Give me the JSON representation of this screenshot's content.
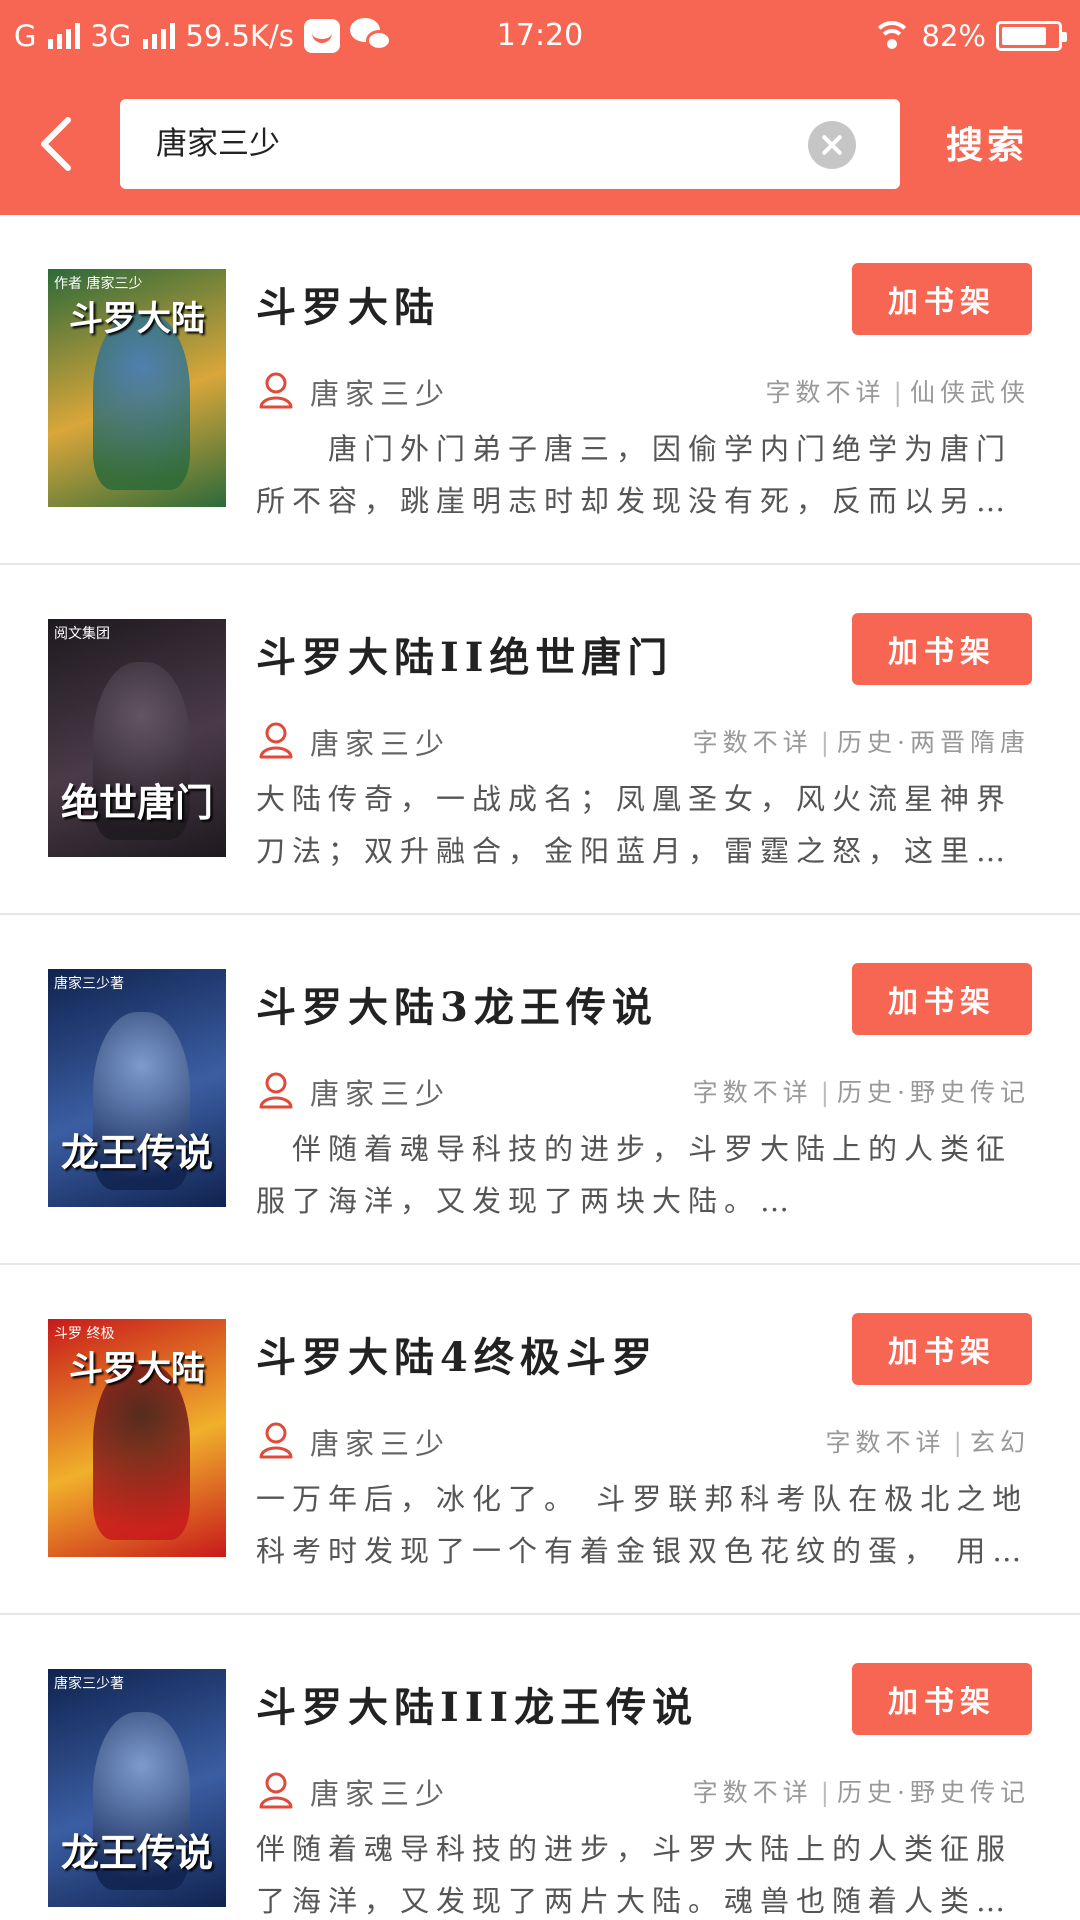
{
  "status_bar": {
    "carrier_1": "G",
    "carrier_2": "3G",
    "net_speed": "59.5K/s",
    "time": "17:20",
    "battery_text": "82%",
    "battery_level": 0.82
  },
  "header": {
    "back_icon": "chevron-left-icon",
    "search_value": "唐家三少",
    "search_button": "搜索",
    "accent_color": "#f66652"
  },
  "books": [
    {
      "title": "斗罗大陆",
      "author": "唐家三少",
      "word_count": "字数不详",
      "category": "仙侠武侠",
      "description": "　　唐门外门弟子唐三，因偷学内门绝学为唐门所不容，跳崖明志时却发现没有死，反而以另…",
      "add_label": "加书架",
      "cover": {
        "text": "斗罗大陆",
        "small": "作者 唐家三少",
        "bg": "#2c6a3a",
        "bg2": "#d9a63a",
        "figure": "#3e7bc4"
      }
    },
    {
      "title": "斗罗大陆II绝世唐门",
      "author": "唐家三少",
      "word_count": "字数不详",
      "category": "历史·两晋隋唐",
      "description": "大陆传奇，一战成名；凤凰圣女，风火流星神界刀法；双升融合，金阳蓝月，雷霆之怒，这里…",
      "add_label": "加书架",
      "cover": {
        "text": "绝世唐门",
        "small": "阅文集团",
        "bg": "#1d1a1e",
        "bg2": "#4b3a48",
        "figure": "#6b5a6a"
      }
    },
    {
      "title": "斗罗大陆3龙王传说",
      "author": "唐家三少",
      "word_count": "字数不详",
      "category": "历史·野史传记",
      "description": "　伴随着魂导科技的进步，斗罗大陆上的人类征服了海洋，又发现了两块大陆。…",
      "add_label": "加书架",
      "cover": {
        "text": "龙王传说",
        "small": "唐家三少著",
        "bg": "#10234f",
        "bg2": "#3b5ea3",
        "figure": "#8aa7d8"
      }
    },
    {
      "title": "斗罗大陆4终极斗罗",
      "author": "唐家三少",
      "word_count": "字数不详",
      "category": "玄幻",
      "description": "一万年后，冰化了。 斗罗联邦科考队在极北之地科考时发现了一个有着金银双色花纹的蛋， 用…",
      "add_label": "加书架",
      "cover": {
        "text": "斗罗大陆",
        "small": "斗罗 终极",
        "bg": "#c8191b",
        "bg2": "#f0b02b",
        "figure": "#3a1c1c"
      }
    },
    {
      "title": "斗罗大陆III龙王传说",
      "author": "唐家三少",
      "word_count": "字数不详",
      "category": "历史·野史传记",
      "description": "伴随着魂导科技的进步，斗罗大陆上的人类征服了海洋，又发现了两片大陆。魂兽也随着人类…",
      "add_label": "加书架",
      "cover": {
        "text": "龙王传说",
        "small": "唐家三少著",
        "bg": "#10234f",
        "bg2": "#3b5ea3",
        "figure": "#8aa7d8"
      }
    }
  ]
}
